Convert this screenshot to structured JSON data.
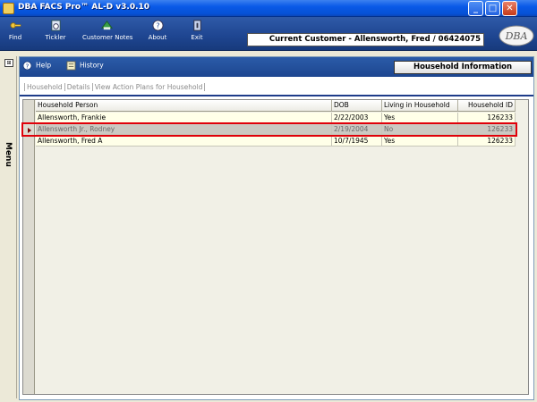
{
  "window": {
    "title": "DBA FACS Pro™ AL-D v3.0.10",
    "controls": {
      "minimize": "_",
      "maximize": "□",
      "close": "✕"
    }
  },
  "toolbar": {
    "find": "Find",
    "tickler": "Tickler",
    "customer_notes": "Customer Notes",
    "about": "About",
    "exit": "Exit",
    "current_customer": "Current Customer - Allensworth, Fred / 06424075",
    "logo_text": "DBA"
  },
  "menu": {
    "label": "Menu",
    "pin_icon": "pin-icon"
  },
  "subbar": {
    "help": "Help",
    "history": "History",
    "section_title": "Household Information"
  },
  "tabs": [
    "Household",
    "Details",
    "View Action Plans for Household"
  ],
  "grid": {
    "columns": [
      "Household Person",
      "DOB",
      "Living in Household",
      "Household ID"
    ],
    "rows": [
      {
        "person": "Allensworth, Frankie",
        "dob": "2/22/2003",
        "living": "Yes",
        "id": "126233"
      },
      {
        "person": "Allensworth Jr., Rodney",
        "dob": "2/19/2004",
        "living": "No",
        "id": "126233"
      },
      {
        "person": "Allensworth, Fred A",
        "dob": "10/7/1945",
        "living": "Yes",
        "id": "126233"
      }
    ],
    "selected_row": 1
  },
  "colors": {
    "toolbar": "#1e4590",
    "selection_outline": "#e0000a",
    "row_background": "#ffffe8"
  }
}
